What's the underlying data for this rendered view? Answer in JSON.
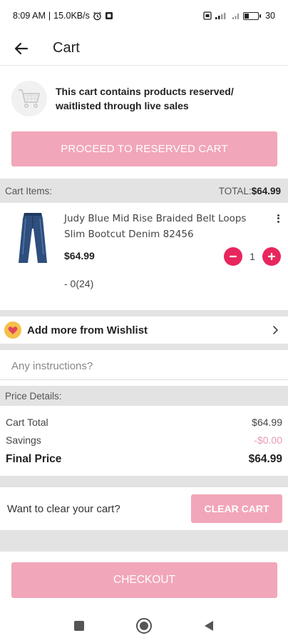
{
  "status_bar": {
    "time": "8:09 AM",
    "network_speed": "15.0KB/s",
    "battery": "30",
    "battery_level": 0.3
  },
  "app_bar": {
    "title": "Cart"
  },
  "notice": {
    "text": "This cart contains products reserved/ waitlisted through live sales"
  },
  "reserved_button": {
    "label": "PROCEED TO RESERVED CART"
  },
  "cart_items_header": {
    "label": "Cart Items:",
    "total_label": "TOTAL:",
    "total_value": "$64.99"
  },
  "items": [
    {
      "name": "Judy Blue Mid Rise Braided Belt Loops Slim Bootcut Denim 82456",
      "price": "$64.99",
      "quantity": "1",
      "variant": "- 0(24)"
    }
  ],
  "wishlist": {
    "label": "Add more from Wishlist"
  },
  "instructions": {
    "placeholder": "Any instructions?"
  },
  "price_details": {
    "header": "Price Details:",
    "cart_total_label": "Cart Total",
    "cart_total_value": "$64.99",
    "savings_label": "Savings",
    "savings_value": "-$0.00",
    "final_label": "Final Price",
    "final_value": "$64.99"
  },
  "clear_cart": {
    "question": "Want to clear your cart?",
    "button_label": "CLEAR CART"
  },
  "checkout": {
    "label": "CHECKOUT"
  },
  "colors": {
    "accent": "#e8265e",
    "button_pink": "#f2a6b9",
    "section_gray": "#e3e3e3",
    "savings": "#e89ab0"
  }
}
